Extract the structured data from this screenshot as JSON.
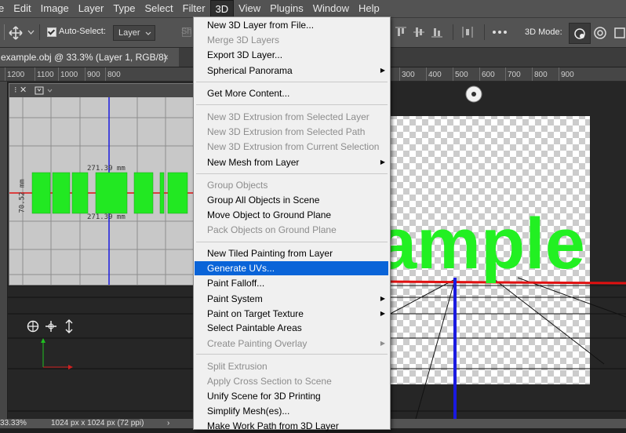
{
  "menubar": {
    "items": [
      "e",
      "Edit",
      "Image",
      "Layer",
      "Type",
      "Select",
      "Filter",
      "3D",
      "View",
      "Plugins",
      "Window",
      "Help"
    ],
    "active": "3D"
  },
  "options": {
    "autoselect_label": "Auto-Select:",
    "autoselect_value": "Layer",
    "hidden_label": "Sh",
    "mode_label": "3D Mode:"
  },
  "document": {
    "tab_title": "example.obj @ 33.3% (Layer 1, RGB/8)",
    "close_glyph": "×"
  },
  "ruler": {
    "left_ticks": [
      "1200",
      "1100",
      "1000",
      "900",
      "800"
    ],
    "right_ticks": [
      "300",
      "400",
      "500",
      "600",
      "700",
      "800",
      "900"
    ]
  },
  "secondary_view": {
    "dim_top": "271.39 mm",
    "dim_bottom": "271.39 mm",
    "dim_side": "70.52 mm"
  },
  "scene_text": "ample",
  "status": {
    "zoom": "33.33%",
    "doc_size": "1024 px x 1024 px (72 ppi)",
    "arrow": "›"
  },
  "menu3d": {
    "items": [
      {
        "label": "New 3D Layer from File...",
        "enabled": true
      },
      {
        "label": "Merge 3D Layers",
        "enabled": false
      },
      {
        "label": "Export 3D Layer...",
        "enabled": true
      },
      {
        "label": "Spherical Panorama",
        "enabled": true,
        "submenu": true
      },
      {
        "label": "Get More Content...",
        "enabled": true
      },
      {
        "label": "New 3D Extrusion from Selected Layer",
        "enabled": false
      },
      {
        "label": "New 3D Extrusion from Selected Path",
        "enabled": false
      },
      {
        "label": "New 3D Extrusion from Current Selection",
        "enabled": false
      },
      {
        "label": "New Mesh from Layer",
        "enabled": true,
        "submenu": true
      },
      {
        "label": "Group Objects",
        "enabled": false
      },
      {
        "label": "Group All Objects in Scene",
        "enabled": true
      },
      {
        "label": "Move Object to Ground Plane",
        "enabled": true
      },
      {
        "label": "Pack Objects on Ground Plane",
        "enabled": false
      },
      {
        "label": "New Tiled Painting from Layer",
        "enabled": true
      },
      {
        "label": "Generate UVs...",
        "enabled": true,
        "highlighted": true
      },
      {
        "label": "Paint Falloff...",
        "enabled": true
      },
      {
        "label": "Paint System",
        "enabled": true,
        "submenu": true
      },
      {
        "label": "Paint on Target Texture",
        "enabled": true,
        "submenu": true
      },
      {
        "label": "Select Paintable Areas",
        "enabled": true
      },
      {
        "label": "Create Painting Overlay",
        "enabled": false,
        "submenu": true
      },
      {
        "label": "Split Extrusion",
        "enabled": false
      },
      {
        "label": "Apply Cross Section to Scene",
        "enabled": false
      },
      {
        "label": "Unify Scene for 3D Printing",
        "enabled": true
      },
      {
        "label": "Simplify Mesh(es)...",
        "enabled": true
      },
      {
        "label": "Make Work Path from 3D Layer",
        "enabled": true
      }
    ],
    "submenu_arrow": "▶"
  },
  "colors": {
    "accent": "#0a64d8",
    "model_green": "#22f022",
    "axis_red": "#e01010",
    "axis_blue": "#1a1ae0"
  }
}
